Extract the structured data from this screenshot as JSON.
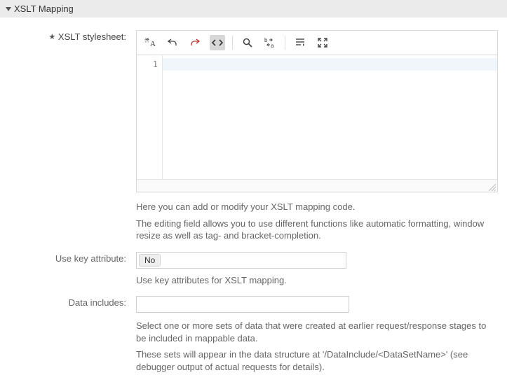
{
  "section": {
    "title": "XSLT Mapping"
  },
  "stylesheet": {
    "label": "XSLT stylesheet:",
    "required_marker": "★",
    "gutter_first_line": "1",
    "help1": "Here you can add or modify your XSLT mapping code.",
    "help2": "The editing field allows you to use different functions like automatic formatting, window resize as well as tag- and bracket-completion."
  },
  "toolbar": {
    "icons": [
      "format-text",
      "undo",
      "redo",
      "code-view",
      "search",
      "replace",
      "wrap",
      "fullscreen"
    ]
  },
  "useKey": {
    "label": "Use key attribute:",
    "value": "No",
    "help": "Use key attributes for XSLT mapping."
  },
  "dataIncludes": {
    "label": "Data includes:",
    "value": "",
    "help1": "Select one or more sets of data that were created at earlier request/response stages to be included in mappable data.",
    "help2": "These sets will appear in the data structure at '/DataInclude/<DataSetName>' (see debugger output of actual requests for details)."
  }
}
